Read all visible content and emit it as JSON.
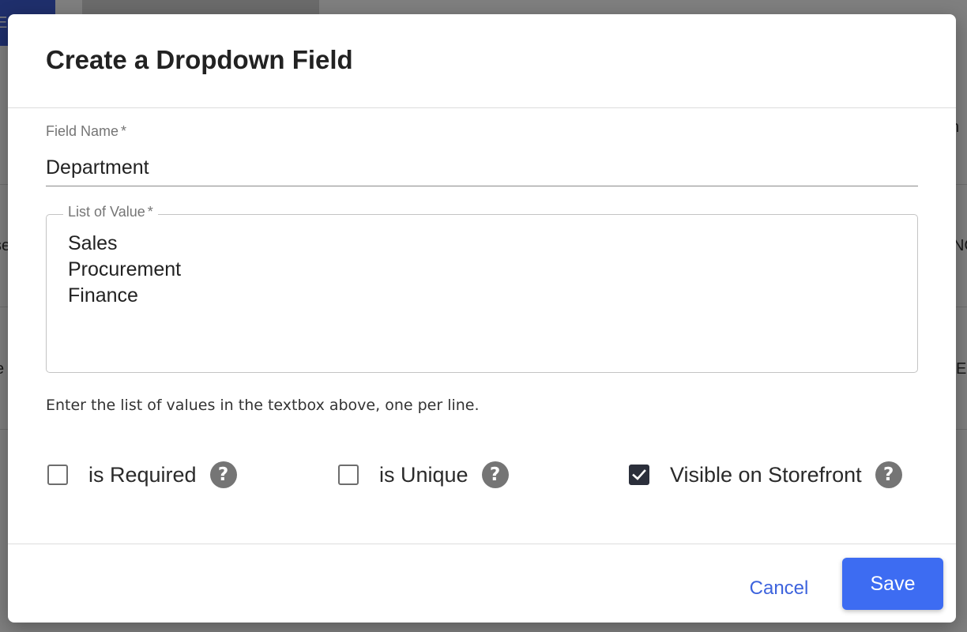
{
  "dialog": {
    "title": "Create a Dropdown Field",
    "field_name": {
      "label": "Field Name",
      "required_marker": "*",
      "value": "Department"
    },
    "list_of_values": {
      "label": "List of Value",
      "required_marker": "*",
      "value": "Sales\nProcurement\nFinance"
    },
    "helper_text": "Enter the list of values in the textbox above, one per line.",
    "checkboxes": [
      {
        "label": "is Required",
        "checked": false,
        "help_icon": "question-circle-icon"
      },
      {
        "label": "is Unique",
        "checked": false,
        "help_icon": "question-circle-icon"
      },
      {
        "label": "Visible on Storefront",
        "checked": true,
        "help_icon": "question-circle-icon"
      }
    ],
    "help_glyph": "?",
    "cancel_label": "Cancel",
    "save_label": "Save"
  },
  "background": {
    "top_button_glyph": "E",
    "fragments": [
      "n",
      "se",
      "NO",
      "e",
      "E"
    ]
  },
  "colors": {
    "primary": "#3d6cf2",
    "link": "#3d63dd",
    "checked_box": "#2b2f3b",
    "help_icon": "#757575"
  }
}
